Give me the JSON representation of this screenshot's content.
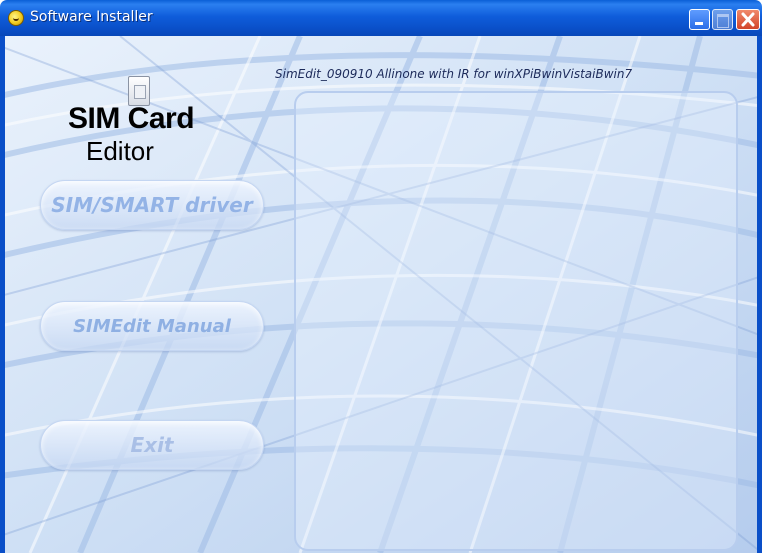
{
  "window": {
    "title": "Software Installer",
    "controls": [
      "minimize",
      "maximize",
      "close"
    ]
  },
  "header": {
    "version_label": "SimEdit_090910 Allinone with IR for winXPiBwinVistaiBwin7"
  },
  "logo": {
    "line1": "SIM Card",
    "line2": "Editor"
  },
  "menu": {
    "driver_label": "SIM/SMART driver",
    "manual_label": "SIMEdit Manual",
    "exit_label": "Exit"
  },
  "icons": {
    "app_icon": "app-icon",
    "sim_card_icon": "sim-card-icon",
    "minimize": "minimize-icon",
    "maximize": "maximize-icon",
    "close": "close-icon"
  },
  "colors": {
    "titlebar": "#0a4fc8",
    "button_text": "#93b3e6",
    "background": "#d9e6f7"
  }
}
